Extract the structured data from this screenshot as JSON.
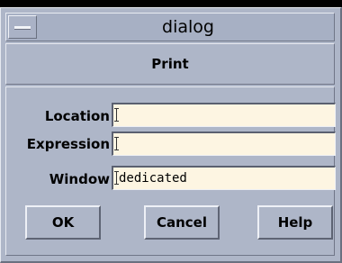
{
  "window": {
    "title": "dialog"
  },
  "dialog": {
    "heading": "Print",
    "fields": [
      {
        "label": "Location",
        "value": ""
      },
      {
        "label": "Expression",
        "value": ""
      },
      {
        "label": "Window",
        "value": "dedicated"
      }
    ],
    "buttons": {
      "ok": "OK",
      "cancel": "Cancel",
      "help": "Help"
    }
  }
}
